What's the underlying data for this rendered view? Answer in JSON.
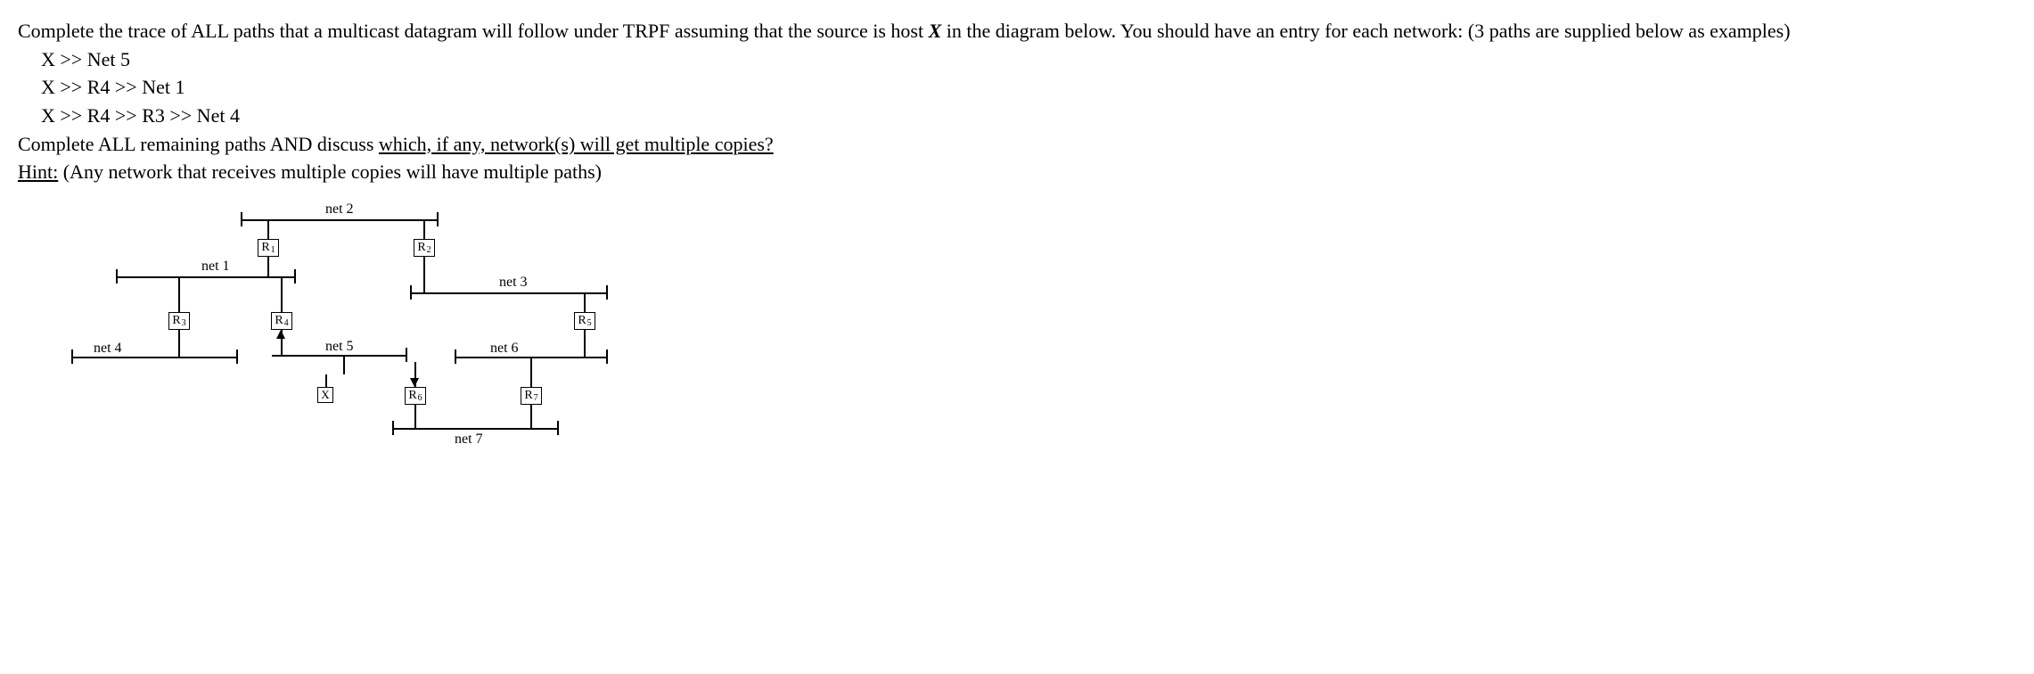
{
  "question": {
    "intro_a": "Complete the trace of ALL paths that a multicast datagram will follow under TRPF assuming that the source is host ",
    "intro_x": "X",
    "intro_b": " in the diagram below. You should have an entry for each network: (3 paths are supplied below as examples)",
    "examples": [
      "X >> Net 5",
      "X >> R4 >> Net 1",
      "X >> R4 >> R3 >> Net 4"
    ],
    "task_a": "Complete ALL remaining paths AND discuss ",
    "task_underline": "which, if any, network(s) will get multiple copies?",
    "hint_label": "Hint:",
    "hint_text": "  (Any network that receives multiple copies will have multiple paths)"
  },
  "diagram": {
    "nets": {
      "n1": "net 1",
      "n2": "net 2",
      "n3": "net 3",
      "n4": "net 4",
      "n5": "net 5",
      "n6": "net 6",
      "n7": "net 7"
    },
    "routers": {
      "r1": "R",
      "r1s": "1",
      "r2": "R",
      "r2s": "2",
      "r3": "R",
      "r3s": "3",
      "r4": "R",
      "r4s": "4",
      "r5": "R",
      "r5s": "5",
      "r6": "R",
      "r6s": "6",
      "r7": "R",
      "r7s": "7"
    },
    "host": "X"
  }
}
